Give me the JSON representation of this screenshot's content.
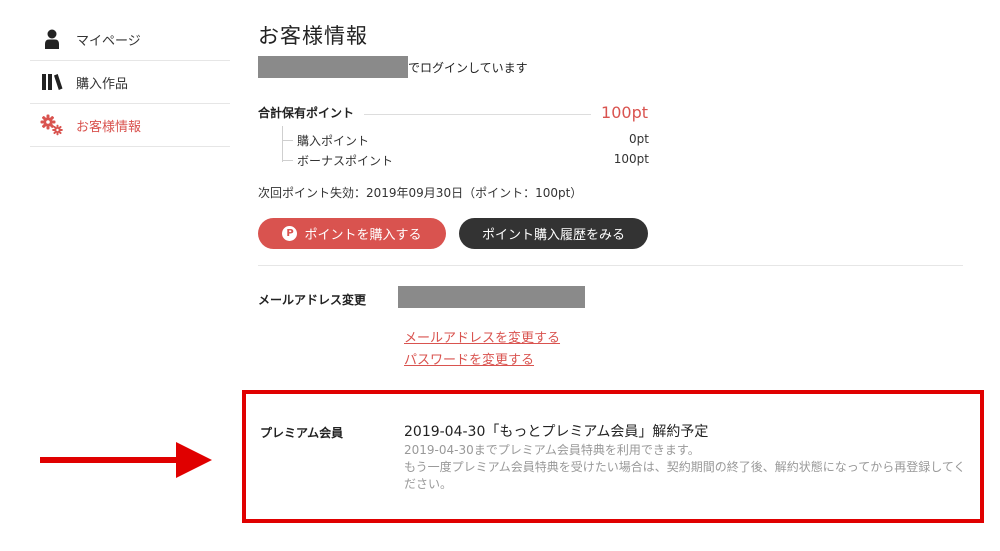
{
  "sidebar": {
    "items": [
      {
        "label": "マイページ",
        "icon": "user-icon"
      },
      {
        "label": "購入作品",
        "icon": "books-icon"
      },
      {
        "label": "お客様情報",
        "icon": "gears-icon",
        "active": true
      }
    ]
  },
  "page": {
    "title": "お客様情報",
    "login_text": "でログインしています"
  },
  "points": {
    "total_label": "合計保有ポイント",
    "total_value": "100pt",
    "purchase_label": "購入ポイント",
    "purchase_value": "0pt",
    "bonus_label": "ボーナスポイント",
    "bonus_value": "100pt",
    "expiry_text": "次回ポイント失効：2019年09月30日（ポイント：100pt）"
  },
  "buttons": {
    "buy_points": "ポイントを購入する",
    "buy_icon_letter": "P",
    "history": "ポイント購入履歴をみる"
  },
  "account": {
    "mail_label": "メールアドレス変更",
    "change_mail_link": "メールアドレスを変更する",
    "change_password_link": "パスワードを変更する"
  },
  "premium": {
    "label": "プレミアム会員",
    "status": "2019-04-30「もっとプレミアム会員」解約予定",
    "note_line1": "2019-04-30までプレミアム会員特典を利用できます。",
    "note_line2": "もう一度プレミアム会員特典を受けたい場合は、契約期間の終了後、解約状態になってから再登録してください。"
  },
  "colors": {
    "accent": "#d9534f",
    "dark_button": "#333333",
    "highlight_box": "#e00000",
    "redaction": "#8a8a8a"
  }
}
